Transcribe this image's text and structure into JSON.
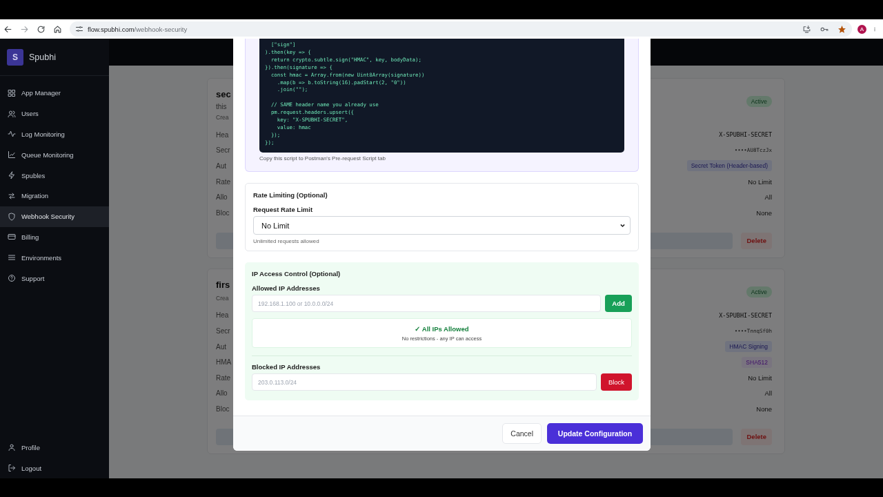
{
  "browser": {
    "url_domain": "flow.spubhi.com",
    "url_path": "/webhook-security",
    "avatar": "A"
  },
  "sidebar": {
    "brand_initial": "S",
    "brand": "Spubhi",
    "items": [
      {
        "label": "App Manager",
        "selected": false
      },
      {
        "label": "Users",
        "selected": false
      },
      {
        "label": "Log Monitoring",
        "selected": false
      },
      {
        "label": "Queue Monitoring",
        "selected": false
      },
      {
        "label": "Spubles",
        "selected": false
      },
      {
        "label": "Migration",
        "selected": false
      },
      {
        "label": "Webhook Security",
        "selected": true
      },
      {
        "label": "Billing",
        "selected": false
      },
      {
        "label": "Environments",
        "selected": false
      },
      {
        "label": "Support",
        "selected": false
      }
    ],
    "bottom_items": [
      {
        "label": "Profile"
      },
      {
        "label": "Logout"
      }
    ]
  },
  "webhooks": [
    {
      "title": "sec",
      "description": "this",
      "created": "Crea",
      "status": "Active",
      "delete": "Delete",
      "rows": [
        {
          "label": "Hea",
          "value": "X-SPUBHI-SECRET",
          "kind": "mono"
        },
        {
          "label": "Secr",
          "value": "••••AU8TczJx",
          "kind": "secret"
        },
        {
          "label": "Aut",
          "value": "Secret Token (Header-based)",
          "kind": "badge"
        },
        {
          "label": "Rate",
          "value": "No Limit",
          "kind": "text"
        },
        {
          "label": "Allo",
          "value": "All",
          "kind": "text"
        },
        {
          "label": "Bloc",
          "value": "None",
          "kind": "text"
        }
      ]
    },
    {
      "title": "firs",
      "created": "Crea",
      "status": "Active",
      "delete": "Delete",
      "rows": [
        {
          "label": "Hea",
          "value": "X-SPUBHI-SECRET",
          "kind": "mono"
        },
        {
          "label": "Secr",
          "value": "••••TnnqSf0h",
          "kind": "secret"
        },
        {
          "label": "Aut",
          "value": "HMAC Signing",
          "kind": "badge"
        },
        {
          "label": "HMA",
          "value": "SHA512",
          "kind": "algorithm"
        },
        {
          "label": "Rate",
          "value": "No Limit",
          "kind": "text"
        },
        {
          "label": "Allo",
          "value": "All",
          "kind": "text"
        },
        {
          "label": "Bloc",
          "value": "None",
          "kind": "text"
        }
      ]
    }
  ],
  "modal": {
    "code": "  [\"sign\"]\n).then(key => {\n  return crypto.subtle.sign(\"HMAC\", key, bodyData);\n}).then(signature => {\n  const hmac = Array.from(new Uint8Array(signature))\n    .map(b => b.toString(16).padStart(2, \"0\"))\n    .join(\"\");\n\n  // SAME header name you already use\n  pm.request.headers.upsert({\n    key: \"X-SPUBHI-SECRET\",\n    value: hmac\n  });\n});",
    "code_caption": "Copy this script to Postman's Pre-request Script tab",
    "rate_limiting": {
      "title": "Rate Limiting (Optional)",
      "field_label": "Request Rate Limit",
      "value": "No Limit",
      "hint": "Unlimited requests allowed"
    },
    "ip_access": {
      "title": "IP Access Control (Optional)",
      "allowed_label": "Allowed IP Addresses",
      "allowed_placeholder": "192.168.1.100 or 10.0.0.0/24",
      "add_button": "Add",
      "status_title": "✓ All IPs Allowed",
      "status_text": "No restrictions - any IP can access",
      "blocked_label": "Blocked IP Addresses",
      "blocked_placeholder": "203.0.113.0/24",
      "block_button": "Block"
    },
    "buttons": {
      "cancel": "Cancel",
      "confirm": "Update Configuration"
    }
  }
}
